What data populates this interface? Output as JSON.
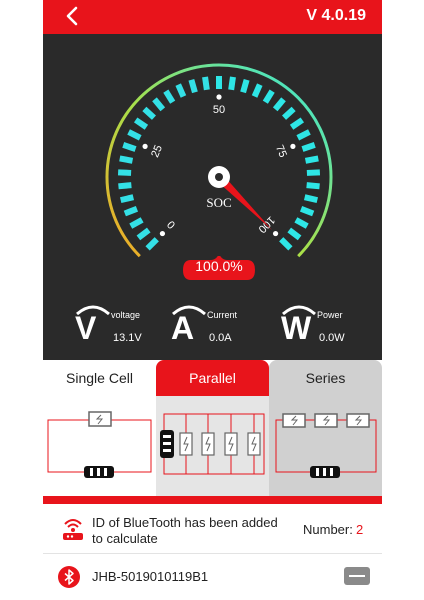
{
  "header": {
    "version": "V 4.0.19",
    "back_icon": "chevron-left-icon"
  },
  "gauge": {
    "ticks": [
      "0",
      "25",
      "50",
      "75",
      "100"
    ],
    "center_label": "SOC",
    "soc_value": "100.0%",
    "soc_fraction": 1.0,
    "colors": {
      "arc_start": "#f5a623",
      "arc_mid": "#a8e04a",
      "arc_end": "#2ee6e6",
      "needle": "#e8141b"
    }
  },
  "meters": [
    {
      "letter": "V",
      "label": "voltage",
      "value": "13.1V"
    },
    {
      "letter": "A",
      "label": "Current",
      "value": "0.0A"
    },
    {
      "letter": "W",
      "label": "Power",
      "value": "0.0W"
    }
  ],
  "modes": [
    {
      "label": "Single Cell",
      "selected": false
    },
    {
      "label": "Parallel",
      "selected": true
    },
    {
      "label": "Series",
      "selected": false
    }
  ],
  "info": {
    "text": "ID of BlueTooth has been added to calculate",
    "number_label": "Number:",
    "number_value": "2"
  },
  "device": {
    "name": "JHB-5019010119B1",
    "icon": "bluetooth-icon"
  },
  "accent": "#e8141b"
}
